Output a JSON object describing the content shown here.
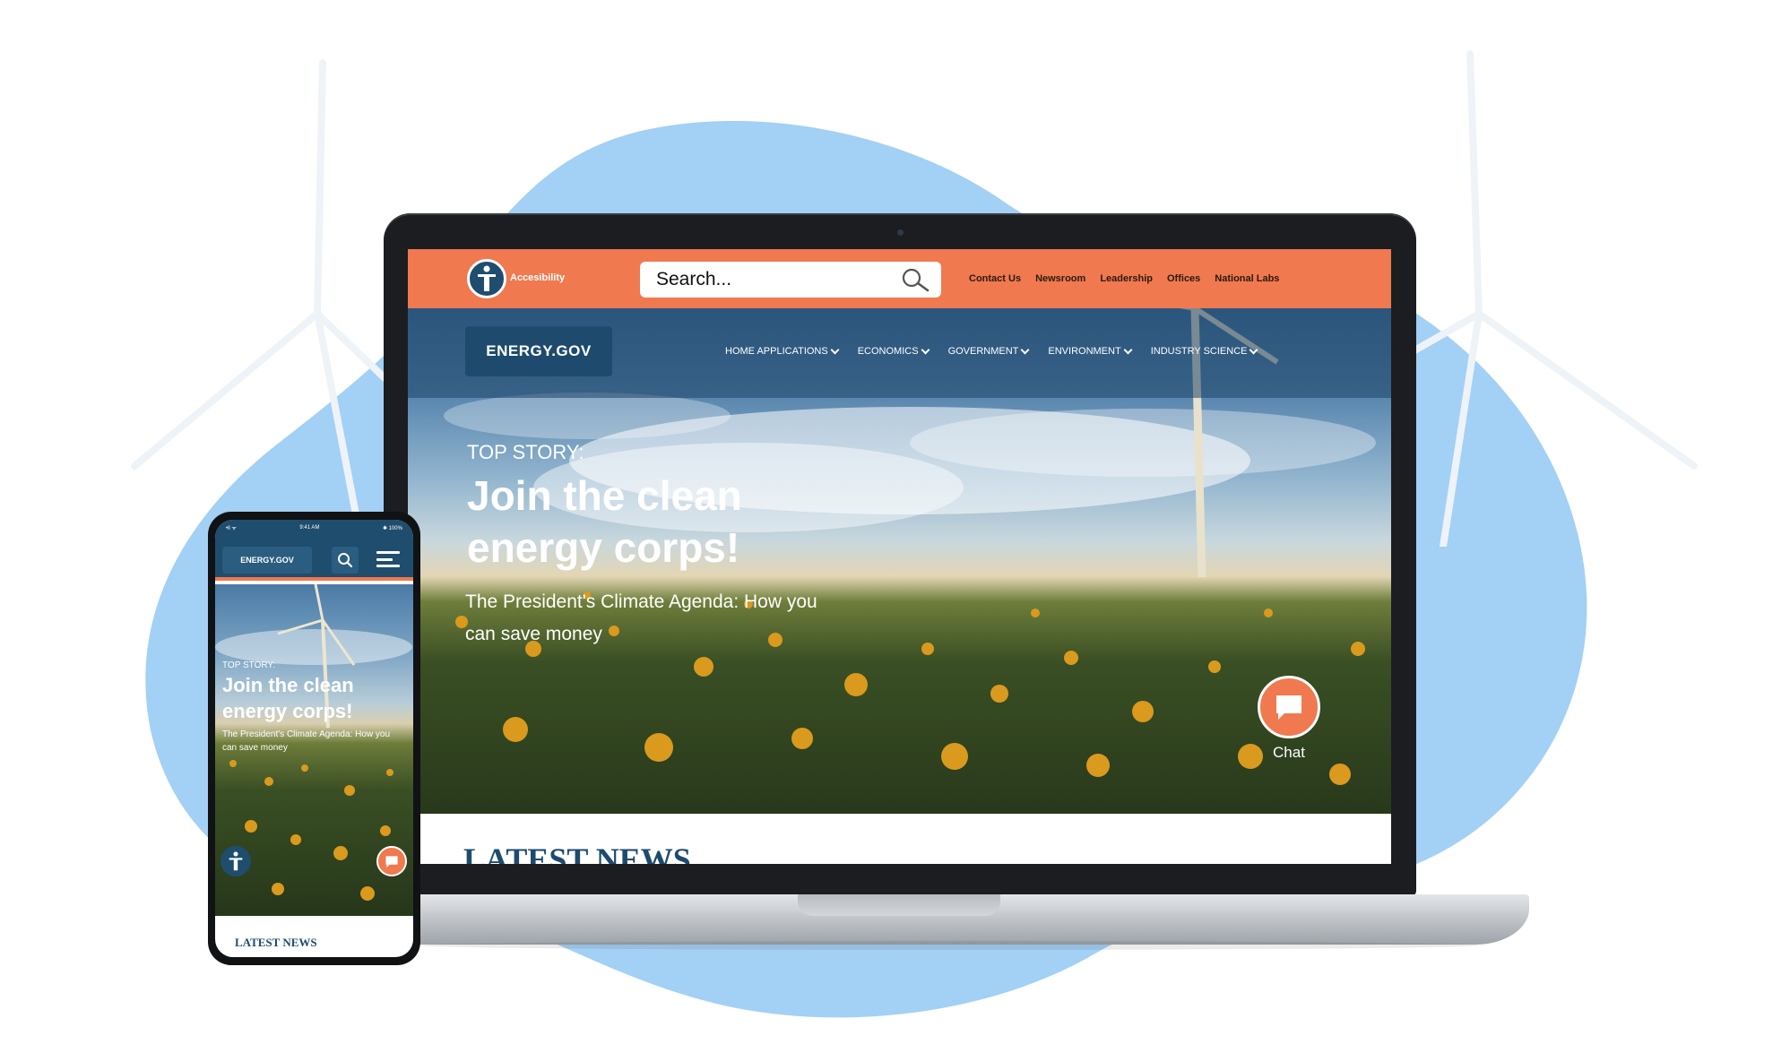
{
  "colors": {
    "accent": "#f0794f",
    "brand_navy": "#1f4d6e",
    "blob": "#a3d0f5"
  },
  "laptop": {
    "top_bar": {
      "accessibility_label": "Accesibility",
      "search_placeholder": "Search...",
      "utility_links": [
        "Contact Us",
        "Newsroom",
        "Leadership",
        "Offices",
        "National Labs"
      ]
    },
    "nav": {
      "logo": "ENERGY.GOV",
      "items": [
        "HOME APPLICATIONS",
        "ECONOMICS",
        "GOVERNMENT",
        "ENVIRONMENT",
        "INDUSTRY SCIENCE"
      ]
    },
    "hero": {
      "label": "TOP STORY:",
      "title": "Join the clean energy corps!",
      "subtitle": "The President's Climate Agenda: How you can save money"
    },
    "chat_label": "Chat",
    "latest_news": "LATEST NEWS"
  },
  "phone": {
    "status_left": "•ll ᯤ",
    "status_time": "9:41 AM",
    "status_right": "✱ 100%",
    "logo": "ENERGY.GOV",
    "hero": {
      "label": "TOP STORY:",
      "title": "Join the clean energy corps!",
      "subtitle": "The President's Climate Agenda: How you can save money"
    },
    "latest_news": "LATEST NEWS"
  },
  "icons": [
    "accessibility-icon",
    "search-icon",
    "chevron-down-icon",
    "chat-icon",
    "menu-icon",
    "wind-turbine-icon"
  ]
}
